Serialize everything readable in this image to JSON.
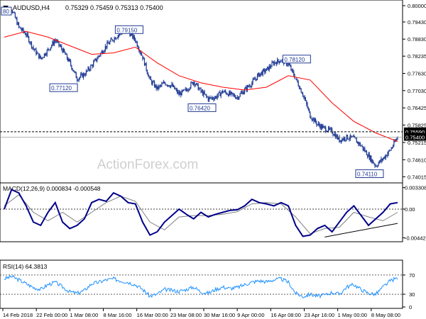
{
  "chart_data": {
    "type": "candlestick",
    "header": {
      "symbol_tf": "AUDUSD,H4",
      "ohlc": "0.75329 0.75459 0.75313 0.75400"
    },
    "watermark": "ActionForex.com",
    "x_ticks": [
      "14 Feb 2018",
      "22 Feb 00:00",
      "1 Mar 08:00",
      "8 Mar 16:00",
      "16 Mar 00:00",
      "23 Mar 08:00",
      "30 Mar 16:00",
      "9 Apr 00:00",
      "16 Apr 08:00",
      "23 Apr 16:00",
      "1 May 00:00",
      "8 May 08:00"
    ],
    "price_panel": {
      "ylim": [
        0.739,
        0.801
      ],
      "y_ticks": [
        "0.80000",
        "0.79430",
        "0.78830",
        "0.78235",
        "0.77630",
        "0.77030",
        "0.76425",
        "0.75825",
        "0.75215",
        "0.74610",
        "0.74015"
      ],
      "ma_color": "#ff0000",
      "candle_color": "#1f3a93",
      "price_points": [
        [
          0,
          0.798
        ],
        [
          2,
          0.799
        ],
        [
          4,
          0.7925
        ],
        [
          6,
          0.79
        ],
        [
          8,
          0.785
        ],
        [
          10,
          0.7815
        ],
        [
          12,
          0.7845
        ],
        [
          14,
          0.788
        ],
        [
          16,
          0.7845
        ],
        [
          18,
          0.78
        ],
        [
          20,
          0.7745
        ],
        [
          22,
          0.776
        ],
        [
          24,
          0.779
        ],
        [
          26,
          0.7825
        ],
        [
          28,
          0.786
        ],
        [
          30,
          0.7885
        ],
        [
          32,
          0.7905
        ],
        [
          34,
          0.791
        ],
        [
          36,
          0.788
        ],
        [
          38,
          0.782
        ],
        [
          40,
          0.774
        ],
        [
          42,
          0.771
        ],
        [
          44,
          0.773
        ],
        [
          46,
          0.772
        ],
        [
          48,
          0.769
        ],
        [
          50,
          0.7705
        ],
        [
          52,
          0.7735
        ],
        [
          54,
          0.77
        ],
        [
          56,
          0.7675
        ],
        [
          58,
          0.768
        ],
        [
          60,
          0.77
        ],
        [
          62,
          0.769
        ],
        [
          64,
          0.768
        ],
        [
          66,
          0.7705
        ],
        [
          68,
          0.773
        ],
        [
          70,
          0.776
        ],
        [
          72,
          0.7775
        ],
        [
          74,
          0.78
        ],
        [
          76,
          0.781
        ],
        [
          78,
          0.7795
        ],
        [
          80,
          0.7745
        ],
        [
          82,
          0.769
        ],
        [
          84,
          0.7615
        ],
        [
          86,
          0.7585
        ],
        [
          88,
          0.757
        ],
        [
          90,
          0.756
        ],
        [
          92,
          0.753
        ],
        [
          94,
          0.754
        ],
        [
          96,
          0.7535
        ],
        [
          98,
          0.751
        ],
        [
          100,
          0.7475
        ],
        [
          102,
          0.744
        ],
        [
          104,
          0.7465
        ],
        [
          106,
          0.7495
        ],
        [
          108,
          0.754
        ]
      ],
      "ma_points": [
        [
          0,
          0.789
        ],
        [
          6,
          0.791
        ],
        [
          12,
          0.789
        ],
        [
          18,
          0.786
        ],
        [
          24,
          0.783
        ],
        [
          30,
          0.7835
        ],
        [
          36,
          0.7855
        ],
        [
          42,
          0.78
        ],
        [
          48,
          0.7755
        ],
        [
          54,
          0.773
        ],
        [
          60,
          0.7715
        ],
        [
          66,
          0.7705
        ],
        [
          72,
          0.7715
        ],
        [
          78,
          0.7755
        ],
        [
          84,
          0.774
        ],
        [
          90,
          0.766
        ],
        [
          96,
          0.7595
        ],
        [
          102,
          0.7555
        ],
        [
          108,
          0.7525
        ]
      ],
      "labels": [
        {
          "text": "0.79150",
          "x": 34,
          "y": 0.7915
        },
        {
          "text": "0.77120",
          "x": 16,
          "y": 0.7712
        },
        {
          "text": "0.76420",
          "x": 54,
          "y": 0.7642
        },
        {
          "text": "0.78120",
          "x": 80,
          "y": 0.7812
        },
        {
          "text": "0.74110",
          "x": 100,
          "y": 0.7411
        },
        {
          "text": "80",
          "x": 0,
          "y": 0.798
        }
      ],
      "hline": {
        "label": "0.75590",
        "value": 0.7559
      },
      "last_price": {
        "label": "0.75400",
        "value": 0.754
      }
    },
    "macd_panel": {
      "title": "MACD(12,26,9) 0.000834 -0.000548",
      "ylim": [
        -0.0047,
        0.0036
      ],
      "y_ticks": [
        "0.003308",
        "0.00",
        "-0.004427"
      ],
      "main_color": "#00008b",
      "signal_color": "#808080",
      "main_points": [
        [
          0,
          0.0
        ],
        [
          2,
          0.003
        ],
        [
          4,
          0.0025
        ],
        [
          6,
          0.0005
        ],
        [
          8,
          -0.002
        ],
        [
          10,
          -0.0025
        ],
        [
          12,
          -0.0005
        ],
        [
          14,
          0.001
        ],
        [
          16,
          -0.002
        ],
        [
          18,
          -0.003
        ],
        [
          20,
          -0.0025
        ],
        [
          22,
          -0.0015
        ],
        [
          24,
          0.001
        ],
        [
          26,
          0.0015
        ],
        [
          28,
          0.0012
        ],
        [
          30,
          0.0025
        ],
        [
          32,
          0.002
        ],
        [
          34,
          0.001
        ],
        [
          36,
          0.0008
        ],
        [
          38,
          -0.002
        ],
        [
          40,
          -0.004
        ],
        [
          42,
          -0.0035
        ],
        [
          44,
          -0.002
        ],
        [
          46,
          -0.001
        ],
        [
          48,
          0.0
        ],
        [
          50,
          -0.0008
        ],
        [
          52,
          -0.0015
        ],
        [
          54,
          -0.0005
        ],
        [
          56,
          -0.0012
        ],
        [
          58,
          -0.0008
        ],
        [
          60,
          -0.0005
        ],
        [
          62,
          -0.0002
        ],
        [
          64,
          -0.0001
        ],
        [
          66,
          0.0005
        ],
        [
          68,
          0.0015
        ],
        [
          70,
          0.001
        ],
        [
          72,
          0.0008
        ],
        [
          74,
          0.0005
        ],
        [
          76,
          0.001
        ],
        [
          78,
          0.0005
        ],
        [
          80,
          -0.0025
        ],
        [
          82,
          -0.0042
        ],
        [
          84,
          -0.004
        ],
        [
          86,
          -0.003
        ],
        [
          88,
          -0.0025
        ],
        [
          90,
          -0.0035
        ],
        [
          92,
          -0.002
        ],
        [
          94,
          -0.0005
        ],
        [
          96,
          0.0005
        ],
        [
          98,
          -0.001
        ],
        [
          100,
          -0.0025
        ],
        [
          102,
          -0.0015
        ],
        [
          104,
          -0.0005
        ],
        [
          106,
          0.0008
        ],
        [
          108,
          0.001
        ]
      ],
      "signal_points": [
        [
          0,
          0.0005
        ],
        [
          4,
          0.0022
        ],
        [
          8,
          -0.0005
        ],
        [
          12,
          -0.0018
        ],
        [
          16,
          -0.0005
        ],
        [
          20,
          -0.002
        ],
        [
          24,
          -0.0005
        ],
        [
          28,
          0.001
        ],
        [
          32,
          0.002
        ],
        [
          36,
          0.0012
        ],
        [
          40,
          -0.002
        ],
        [
          44,
          -0.0032
        ],
        [
          48,
          -0.0012
        ],
        [
          52,
          -0.001
        ],
        [
          56,
          -0.001
        ],
        [
          60,
          -0.0008
        ],
        [
          64,
          -0.0004
        ],
        [
          68,
          0.0008
        ],
        [
          72,
          0.001
        ],
        [
          76,
          0.0008
        ],
        [
          80,
          -0.0012
        ],
        [
          84,
          -0.0038
        ],
        [
          88,
          -0.003
        ],
        [
          92,
          -0.0028
        ],
        [
          96,
          -0.0005
        ],
        [
          100,
          -0.0012
        ],
        [
          104,
          -0.0018
        ],
        [
          108,
          -0.0005
        ]
      ],
      "trendline": [
        [
          88,
          -0.0043
        ],
        [
          108,
          -0.0022
        ]
      ]
    },
    "rsi_panel": {
      "title": "RSI(14) 64.3813",
      "ylim": [
        5,
        95
      ],
      "y_ticks": [
        "70",
        "30",
        "0"
      ],
      "levels": [
        70,
        30
      ],
      "line_color": "#1e90ff",
      "points": [
        [
          0,
          62
        ],
        [
          2,
          67
        ],
        [
          4,
          60
        ],
        [
          6,
          52
        ],
        [
          8,
          44
        ],
        [
          10,
          40
        ],
        [
          12,
          50
        ],
        [
          14,
          55
        ],
        [
          16,
          45
        ],
        [
          18,
          35
        ],
        [
          20,
          32
        ],
        [
          22,
          38
        ],
        [
          24,
          52
        ],
        [
          26,
          55
        ],
        [
          28,
          60
        ],
        [
          30,
          62
        ],
        [
          32,
          58
        ],
        [
          34,
          55
        ],
        [
          36,
          50
        ],
        [
          38,
          40
        ],
        [
          40,
          26
        ],
        [
          42,
          30
        ],
        [
          44,
          40
        ],
        [
          46,
          38
        ],
        [
          48,
          36
        ],
        [
          50,
          40
        ],
        [
          52,
          45
        ],
        [
          54,
          35
        ],
        [
          56,
          32
        ],
        [
          58,
          40
        ],
        [
          60,
          45
        ],
        [
          62,
          42
        ],
        [
          64,
          44
        ],
        [
          66,
          50
        ],
        [
          68,
          55
        ],
        [
          70,
          58
        ],
        [
          72,
          56
        ],
        [
          74,
          60
        ],
        [
          76,
          62
        ],
        [
          78,
          55
        ],
        [
          80,
          32
        ],
        [
          82,
          25
        ],
        [
          84,
          30
        ],
        [
          86,
          26
        ],
        [
          88,
          28
        ],
        [
          90,
          34
        ],
        [
          92,
          30
        ],
        [
          94,
          45
        ],
        [
          96,
          50
        ],
        [
          98,
          40
        ],
        [
          100,
          32
        ],
        [
          102,
          30
        ],
        [
          104,
          45
        ],
        [
          106,
          58
        ],
        [
          108,
          64
        ]
      ]
    }
  }
}
